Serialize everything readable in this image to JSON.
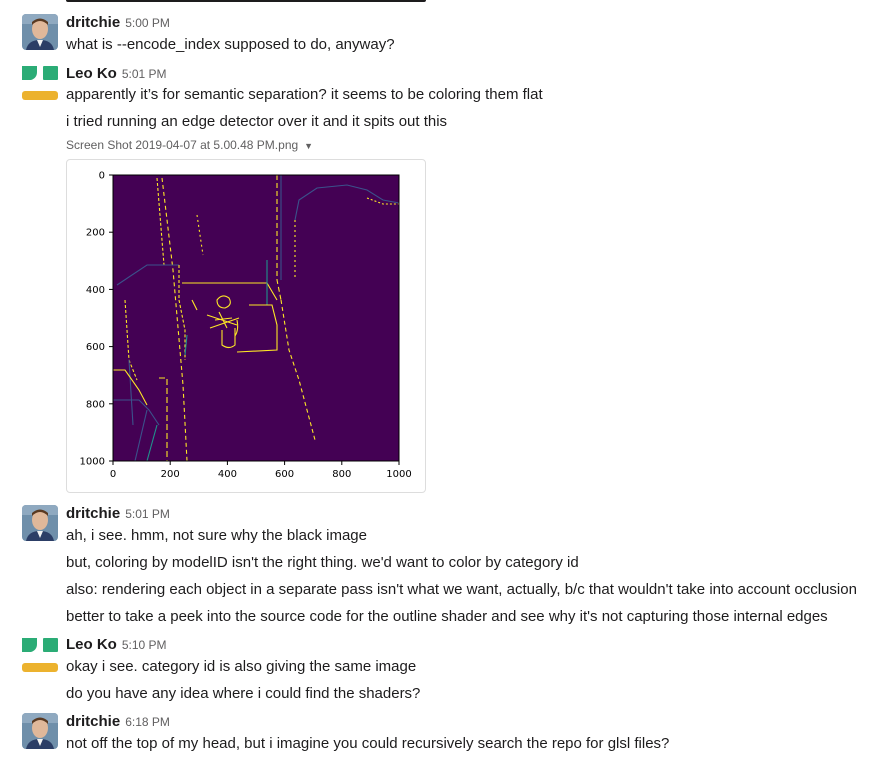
{
  "colors": {
    "accent_green": "#2bac76",
    "accent_yellow": "#ecb22e",
    "plot_bg": "#440154",
    "edge_yellow": "#fde725",
    "edge_teal": "#21918c"
  },
  "messages": [
    {
      "author": "dritchie",
      "time": "5:00 PM",
      "lines": [
        "what is --encode_index supposed to do, anyway?"
      ]
    },
    {
      "author": "Leo Ko",
      "time": "5:01 PM",
      "lines": [
        "apparently it’s for semantic separation? it seems to be coloring them flat",
        "i tried running an edge detector over it and it spits out this"
      ]
    },
    {
      "author": "dritchie",
      "time": "5:01 PM",
      "lines": [
        "ah, i see. hmm, not sure why the black image",
        "but, coloring by modelID isn't the right thing. we'd want to color by category id",
        "also: rendering each object in a separate pass isn't what we want, actually, b/c that wouldn't take into account occlusion",
        "better to take a peek into the source code for the outline shader and see why it's not capturing those internal edges"
      ]
    },
    {
      "author": "Leo Ko",
      "time": "5:10 PM",
      "lines": [
        "okay i see. category id is also giving the same image",
        "do you have any idea where i could find the shaders?"
      ]
    },
    {
      "author": "dritchie",
      "time": "6:18 PM",
      "lines": [
        "not off the top of my head, but i imagine you could recursively search the repo for glsl files?"
      ]
    }
  ],
  "attachment": {
    "filename": "Screen Shot 2019-04-07 at 5.00.48 PM.png"
  },
  "chart_data": {
    "type": "heatmap",
    "title": "",
    "xlabel": "",
    "ylabel": "",
    "xlim": [
      0,
      1000
    ],
    "ylim": [
      1000,
      0
    ],
    "x_ticks": [
      "0",
      "200",
      "400",
      "600",
      "800",
      "1000"
    ],
    "y_ticks": [
      "0",
      "200",
      "400",
      "600",
      "800",
      "1000"
    ]
  }
}
